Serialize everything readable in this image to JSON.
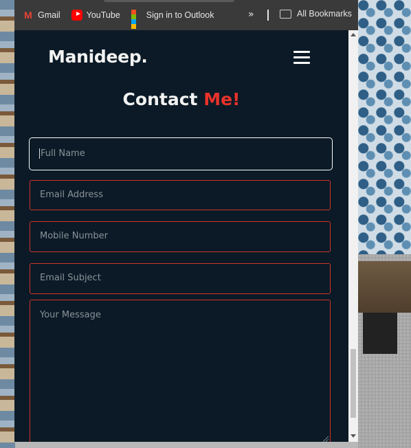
{
  "bookmarks_bar": {
    "items": [
      {
        "label": "Gmail",
        "icon": "gmail-icon"
      },
      {
        "label": "YouTube",
        "icon": "youtube-icon"
      },
      {
        "label": "Sign in to Outlook",
        "icon": "microsoft-icon"
      }
    ],
    "overflow_icon": "double-chevron-icon",
    "all_bookmarks_label": "All Bookmarks"
  },
  "site": {
    "logo": "Manideep.",
    "menu_icon": "hamburger-menu-icon"
  },
  "contact": {
    "heading_main": "Contact",
    "heading_accent": "Me!",
    "fields": {
      "full_name_placeholder": "Full Name",
      "email_placeholder": "Email Address",
      "mobile_placeholder": "Mobile Number",
      "subject_placeholder": "Email Subject",
      "message_placeholder": "Your Message"
    }
  },
  "colors": {
    "page_background": "#0b1a26",
    "accent": "#e8322b",
    "bookmarks_bar": "#3a3a3a"
  }
}
